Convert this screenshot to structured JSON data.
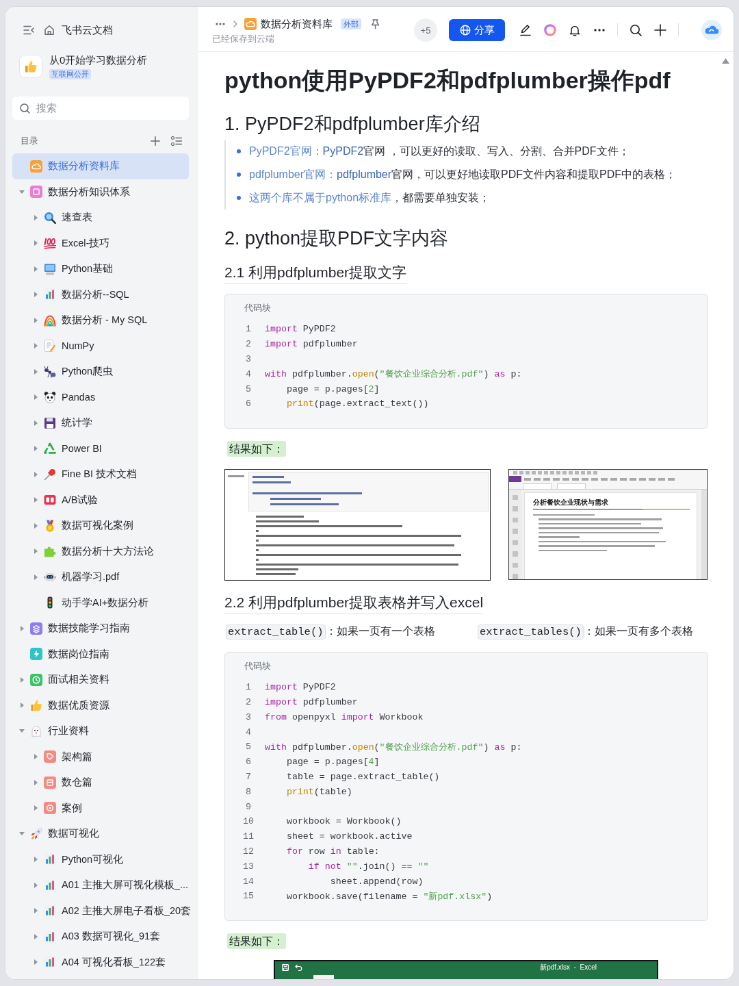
{
  "sidebar": {
    "title": "飞书云文档",
    "space": {
      "name": "从0开始学习数据分析",
      "badge": "互联网公开"
    },
    "search": {
      "placeholder": "搜索"
    },
    "toc_label": "目录",
    "tree": [
      {
        "label": "数据分析资料库",
        "kind": "cloud-tile",
        "selected": true
      },
      {
        "label": "数据分析知识体系",
        "kind": "square-tile",
        "selected": false,
        "expanded": true,
        "children": [
          {
            "label": "速查表",
            "kind": "magnifier",
            "selected": false,
            "expanded": false
          },
          {
            "label": "Excel-技巧",
            "kind": "hundred",
            "selected": false,
            "expanded": false
          },
          {
            "label": "Python基础",
            "kind": "computer",
            "selected": false,
            "expanded": false
          },
          {
            "label": "数据分析--SQL",
            "kind": "bar-chart",
            "selected": false,
            "expanded": false
          },
          {
            "label": "数据分析 - My SQL",
            "kind": "rainbow",
            "selected": false,
            "expanded": false
          },
          {
            "label": "NumPy",
            "kind": "memo",
            "selected": false,
            "expanded": false
          },
          {
            "label": "Python爬虫",
            "kind": "ant",
            "selected": false,
            "expanded": false
          },
          {
            "label": "Pandas",
            "kind": "panda",
            "selected": false,
            "expanded": false
          },
          {
            "label": "统计学",
            "kind": "floppy",
            "selected": false,
            "expanded": false
          },
          {
            "label": "Power BI",
            "kind": "recycle",
            "selected": false,
            "expanded": false
          },
          {
            "label": "Fine BI 技术文档",
            "kind": "pushpin",
            "selected": false,
            "expanded": false
          },
          {
            "label": "A/B试验",
            "kind": "bars-tile",
            "selected": false,
            "expanded": false
          },
          {
            "label": "数据可视化案例",
            "kind": "medal",
            "selected": false,
            "expanded": false
          },
          {
            "label": "数据分析十大方法论",
            "kind": "puzzle",
            "selected": false,
            "expanded": false
          },
          {
            "label": "机器学习.pdf",
            "kind": "robot",
            "selected": false,
            "expanded": false
          },
          {
            "label": "动手学AI+数据分析",
            "kind": "traffic-light",
            "selected": false
          }
        ]
      },
      {
        "label": "数据技能学习指南",
        "kind": "layers-tile",
        "selected": false,
        "expanded": false
      },
      {
        "label": "数据岗位指南",
        "kind": "lightning-tile",
        "selected": false
      },
      {
        "label": "面试相关资料",
        "kind": "clock-tile",
        "selected": false,
        "expanded": false
      },
      {
        "label": "数据优质资源",
        "kind": "thumbs-up",
        "selected": false,
        "expanded": false
      },
      {
        "label": "行业资料",
        "kind": "ghost",
        "selected": false,
        "expanded": true,
        "children": [
          {
            "label": "架构篇",
            "kind": "tag-tile",
            "selected": false,
            "expanded": false
          },
          {
            "label": "数仓篇",
            "kind": "box-tile",
            "selected": false,
            "expanded": false
          },
          {
            "label": "案例",
            "kind": "ring-tile",
            "selected": false,
            "expanded": false
          }
        ]
      },
      {
        "label": "数据可视化",
        "kind": "rocket",
        "selected": false,
        "expanded": true,
        "children": [
          {
            "label": "Python可视化",
            "kind": "bar-chart",
            "selected": false,
            "expanded": false
          },
          {
            "label": "A01 主推大屏可视化模板_...",
            "kind": "bar-chart",
            "selected": false,
            "expanded": false
          },
          {
            "label": "A02 主推大屏电子看板_20套",
            "kind": "bar-chart",
            "selected": false,
            "expanded": false
          },
          {
            "label": "A03 数据可视化_91套",
            "kind": "bar-chart",
            "selected": false,
            "expanded": false
          },
          {
            "label": "A04 可视化看板_122套",
            "kind": "bar-chart",
            "selected": false,
            "expanded": false
          }
        ]
      }
    ]
  },
  "topbar": {
    "breadcrumb": {
      "title": "数据分析资料库",
      "badge": "外部"
    },
    "status": "已经保存到云端",
    "collaborators": "+5",
    "share": "分享"
  },
  "document": {
    "title": "python使用PyPDF2和pdfplumber操作pdf",
    "blocks": [
      {
        "kind": "h2",
        "text": "1. PyPDF2和pdfplumber库介绍"
      },
      {
        "kind": "quote-list",
        "items": [
          {
            "segments": [
              {
                "kind": "link-label",
                "text": "PyPDF2官网："
              },
              {
                "kind": "link",
                "text": "PyPDF2"
              },
              {
                "kind": "plain",
                "text": "官网 ，可以更好的读取、写入、分割、合并PDF文件；"
              }
            ]
          },
          {
            "segments": [
              {
                "kind": "link-label",
                "text": "pdfplumber官网："
              },
              {
                "kind": "link",
                "text": "pdfplumber"
              },
              {
                "kind": "plain",
                "text": "官网，可以更好地读取PDF文件内容和提取PDF中的表格；"
              }
            ]
          },
          {
            "segments": [
              {
                "kind": "link-label",
                "text": "这两个库不属于python标准库"
              },
              {
                "kind": "plain",
                "text": "，都需要单独安装；"
              }
            ]
          }
        ]
      },
      {
        "kind": "h2",
        "text": "2. python提取PDF文字内容"
      },
      {
        "kind": "h3",
        "text": "2.1 利用pdfplumber提取文字"
      },
      {
        "kind": "code",
        "label": "代码块",
        "lines": [
          {
            "number": "1",
            "tokens": [
              {
                "kind": "kw",
                "text": "import"
              },
              {
                "kind": "plain",
                "text": " PyPDF2"
              }
            ]
          },
          {
            "number": "2",
            "tokens": [
              {
                "kind": "kw",
                "text": "import"
              },
              {
                "kind": "plain",
                "text": " pdfplumber"
              }
            ]
          },
          {
            "number": "3"
          },
          {
            "number": "4",
            "tokens": [
              {
                "kind": "kw",
                "text": "with"
              },
              {
                "kind": "plain",
                "text": " pdfplumber."
              },
              {
                "kind": "fn",
                "text": "open"
              },
              {
                "kind": "plain",
                "text": "("
              },
              {
                "kind": "str",
                "text": "\"餐饮企业综合分析.pdf\""
              },
              {
                "kind": "plain",
                "text": ") "
              },
              {
                "kind": "kw",
                "text": "as"
              },
              {
                "kind": "plain",
                "text": " p:"
              }
            ]
          },
          {
            "number": "5",
            "tokens": [
              {
                "kind": "plain",
                "text": "    page = p.pages["
              },
              {
                "kind": "num",
                "text": "2"
              },
              {
                "kind": "plain",
                "text": "]"
              }
            ]
          },
          {
            "number": "6",
            "tokens": [
              {
                "kind": "fn",
                "text": "    print"
              },
              {
                "kind": "plain",
                "text": "(page.extract_text())"
              }
            ]
          }
        ]
      },
      {
        "kind": "highlight",
        "text": "结果如下："
      },
      {
        "kind": "screenshots",
        "items": [
          {
            "kind": "notebook"
          },
          {
            "kind": "pdf-viewer",
            "heading": "分析餐饮企业现状与需求"
          }
        ]
      },
      {
        "kind": "h3",
        "text": "2.2 利用pdfplumber提取表格并写入excel"
      },
      {
        "kind": "api-notes",
        "items": [
          {
            "code": "extract_table()",
            "text": "：如果一页有一个表格"
          },
          {
            "code": "extract_tables()",
            "text": "：如果一页有多个表格"
          }
        ]
      },
      {
        "kind": "code",
        "label": "代码块",
        "lines": [
          {
            "number": "1",
            "tokens": [
              {
                "kind": "kw",
                "text": "import"
              },
              {
                "kind": "plain",
                "text": " PyPDF2"
              }
            ]
          },
          {
            "number": "2",
            "tokens": [
              {
                "kind": "kw",
                "text": "import"
              },
              {
                "kind": "plain",
                "text": " pdfplumber"
              }
            ]
          },
          {
            "number": "3",
            "tokens": [
              {
                "kind": "kw",
                "text": "from"
              },
              {
                "kind": "plain",
                "text": " openpyxl "
              },
              {
                "kind": "kw",
                "text": "import"
              },
              {
                "kind": "plain",
                "text": " Workbook"
              }
            ]
          },
          {
            "number": "4"
          },
          {
            "number": "5",
            "tokens": [
              {
                "kind": "kw",
                "text": "with"
              },
              {
                "kind": "plain",
                "text": " pdfplumber."
              },
              {
                "kind": "fn",
                "text": "open"
              },
              {
                "kind": "plain",
                "text": "("
              },
              {
                "kind": "str",
                "text": "\"餐饮企业综合分析.pdf\""
              },
              {
                "kind": "plain",
                "text": ") "
              },
              {
                "kind": "kw",
                "text": "as"
              },
              {
                "kind": "plain",
                "text": " p:"
              }
            ]
          },
          {
            "number": "6",
            "tokens": [
              {
                "kind": "plain",
                "text": "    page = p.pages["
              },
              {
                "kind": "num",
                "text": "4"
              },
              {
                "kind": "plain",
                "text": "]"
              }
            ]
          },
          {
            "number": "7",
            "tokens": [
              {
                "kind": "plain",
                "text": "    table = page.extract_table()"
              }
            ]
          },
          {
            "number": "8",
            "tokens": [
              {
                "kind": "fn",
                "text": "    print"
              },
              {
                "kind": "plain",
                "text": "(table)"
              }
            ]
          },
          {
            "number": "9"
          },
          {
            "number": "10",
            "tokens": [
              {
                "kind": "plain",
                "text": "    workbook = Workbook()"
              }
            ]
          },
          {
            "number": "11",
            "tokens": [
              {
                "kind": "plain",
                "text": "    sheet = workbook.active"
              }
            ]
          },
          {
            "number": "12",
            "tokens": [
              {
                "kind": "kw",
                "text": "    for"
              },
              {
                "kind": "plain",
                "text": " row "
              },
              {
                "kind": "kw",
                "text": "in"
              },
              {
                "kind": "plain",
                "text": " table:"
              }
            ]
          },
          {
            "number": "13",
            "tokens": [
              {
                "kind": "kw",
                "text": "        if"
              },
              {
                "kind": "kw",
                "text": " not"
              },
              {
                "kind": "str",
                "text": " \"\""
              },
              {
                "kind": "plain",
                "text": ".join() == "
              },
              {
                "kind": "str",
                "text": "\"\""
              }
            ]
          },
          {
            "number": "14",
            "tokens": [
              {
                "kind": "plain",
                "text": "            sheet.append(row)"
              }
            ]
          },
          {
            "number": "15",
            "tokens": [
              {
                "kind": "plain",
                "text": "    workbook.save(filename = "
              },
              {
                "kind": "str",
                "text": "\"新pdf.xlsx\""
              },
              {
                "kind": "plain",
                "text": ")"
              }
            ]
          }
        ]
      },
      {
        "kind": "highlight",
        "text": "结果如下："
      },
      {
        "kind": "excel",
        "title": "新pdf.xlsx  -  Excel"
      }
    ]
  }
}
